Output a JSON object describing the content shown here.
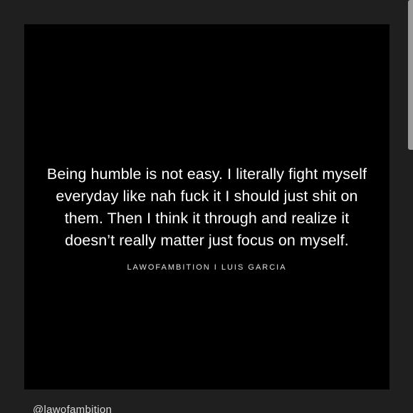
{
  "post": {
    "quote": "Being humble is not easy. I literally fight myself everyday like nah fuck it I should just shit on them. Then I think it through and realize it doesn’t really matter just focus on myself.",
    "attribution": "LAWOFAMBITION I LUIS GARCIA"
  },
  "caption": {
    "handle": "@lawofambition"
  },
  "colors": {
    "page_background": "#1f1f1f",
    "card_background": "#000000",
    "text": "#ffffff",
    "scrollbar": "#9a9a9a"
  }
}
